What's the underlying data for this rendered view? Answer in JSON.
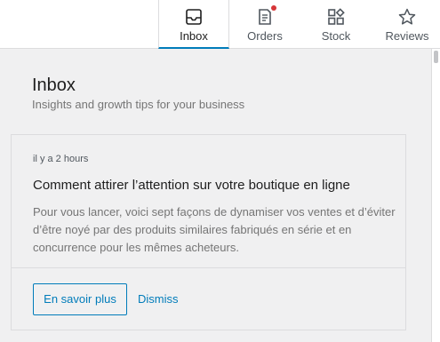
{
  "tabs": [
    {
      "label": "Inbox",
      "icon": "inbox-icon",
      "active": true
    },
    {
      "label": "Orders",
      "icon": "orders-icon",
      "active": false,
      "has_notification": true
    },
    {
      "label": "Stock",
      "icon": "stock-icon",
      "active": false
    },
    {
      "label": "Reviews",
      "icon": "star-icon",
      "active": false
    }
  ],
  "colors": {
    "accent": "#007cba",
    "notification": "#d63638",
    "background": "#f0f0f1"
  },
  "inbox": {
    "title": "Inbox",
    "subtitle": "Insights and growth tips for your business"
  },
  "note": {
    "time": "il y a 2 hours",
    "title": "Comment attirer l’attention sur votre boutique en ligne",
    "body": "Pour vous lancer, voici sept façons de dynamiser vos ventes et d’éviter d’être noyé par des produits similaires fabriqués en série et en concurrence pour les mêmes acheteurs.",
    "primary_action": "En savoir plus",
    "dismiss_action": "Dismiss"
  }
}
